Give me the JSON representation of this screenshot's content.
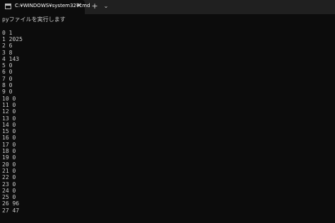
{
  "window": {
    "tab_title": "C:¥WINDOWS¥system32¥cmd",
    "close_glyph": "✕",
    "new_tab_glyph": "+",
    "dropdown_glyph": "⌄",
    "icon": "terminal-icon"
  },
  "console": {
    "lines": [
      "pyファイルを実行します",
      "",
      "0 1",
      "1 2025",
      "2 6",
      "3 8",
      "4 143",
      "5 0",
      "6 0",
      "7 0",
      "8 0",
      "9 0",
      "10 0",
      "11 0",
      "12 0",
      "13 0",
      "14 0",
      "15 0",
      "16 0",
      "17 0",
      "18 0",
      "19 0",
      "20 0",
      "21 0",
      "22 0",
      "23 0",
      "24 0",
      "25 0",
      "26 96",
      "27 47"
    ]
  }
}
